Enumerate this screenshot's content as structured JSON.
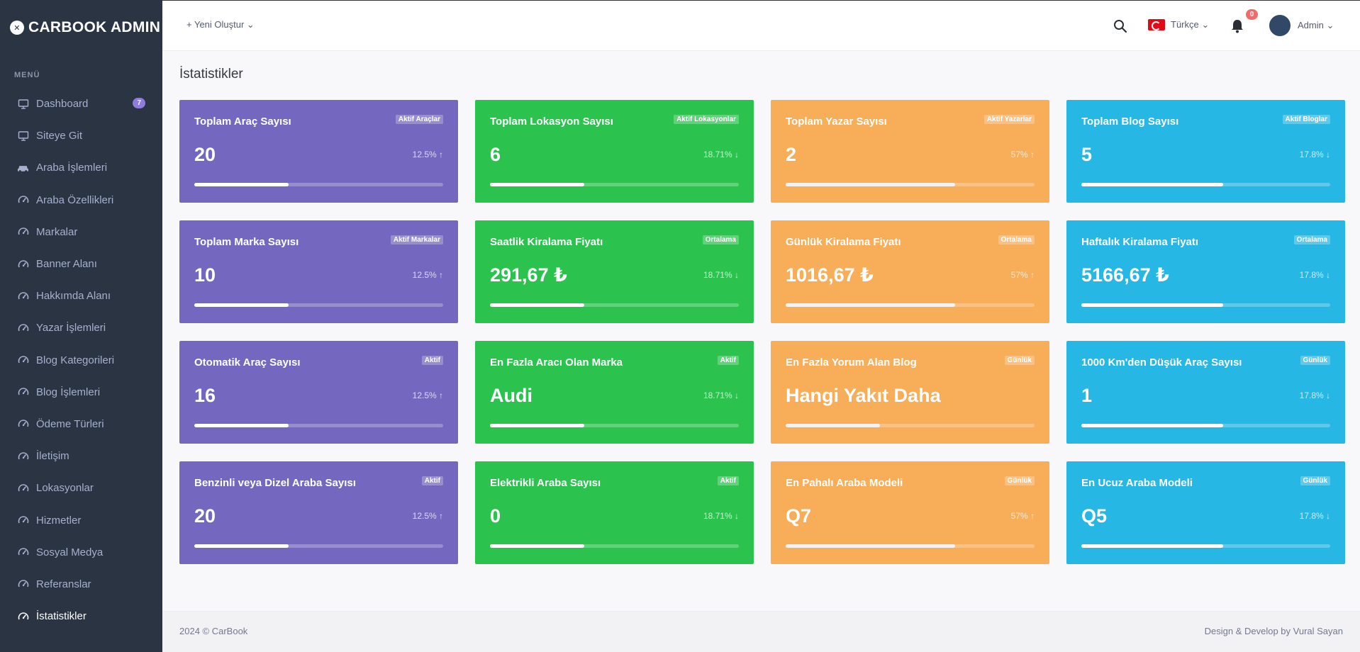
{
  "brand": {
    "name": "CARBOOK ADMIN",
    "icon": "x-logo-icon"
  },
  "sidebar": {
    "menu_title": "MENÜ",
    "items": [
      {
        "label": "Dashboard",
        "icon": "monitor-icon",
        "badge": "7"
      },
      {
        "label": "Siteye Git",
        "icon": "monitor-icon"
      },
      {
        "label": "Araba İşlemleri",
        "icon": "car-icon"
      },
      {
        "label": "Araba Özellikleri",
        "icon": "speedometer-icon"
      },
      {
        "label": "Markalar",
        "icon": "speedometer-icon"
      },
      {
        "label": "Banner Alanı",
        "icon": "speedometer-icon"
      },
      {
        "label": "Hakkımda Alanı",
        "icon": "speedometer-icon"
      },
      {
        "label": "Yazar İşlemleri",
        "icon": "speedometer-icon"
      },
      {
        "label": "Blog Kategorileri",
        "icon": "speedometer-icon"
      },
      {
        "label": "Blog İşlemleri",
        "icon": "speedometer-icon"
      },
      {
        "label": "Ödeme Türleri",
        "icon": "speedometer-icon"
      },
      {
        "label": "İletişim",
        "icon": "speedometer-icon"
      },
      {
        "label": "Lokasyonlar",
        "icon": "speedometer-icon"
      },
      {
        "label": "Hizmetler",
        "icon": "speedometer-icon"
      },
      {
        "label": "Sosyal Medya",
        "icon": "speedometer-icon"
      },
      {
        "label": "Referanslar",
        "icon": "speedometer-icon"
      },
      {
        "label": "İstatistikler",
        "icon": "speedometer-icon",
        "active": true
      }
    ]
  },
  "topbar": {
    "create_new": "+ Yeni Oluştur ⌄",
    "language": "Türkçe ⌄",
    "notification_count": "0",
    "user": "Admin ⌄"
  },
  "page": {
    "title": "İstatistikler"
  },
  "cards": [
    {
      "title": "Toplam Araç Sayısı",
      "badge": "Aktif Araçlar",
      "value": "20",
      "pct": "12.5% ↑",
      "color": "purple",
      "progress": 0.38
    },
    {
      "title": "Toplam Lokasyon Sayısı",
      "badge": "Aktif Lokasyonlar",
      "value": "6",
      "pct": "18.71% ↓",
      "color": "green",
      "progress": 0.38
    },
    {
      "title": "Toplam Yazar Sayısı",
      "badge": "Aktif Yazarlar",
      "value": "2",
      "pct": "57% ↑",
      "color": "orange",
      "progress": 0.68
    },
    {
      "title": "Toplam Blog Sayısı",
      "badge": "Aktif Bloglar",
      "value": "5",
      "pct": "17.8% ↓",
      "color": "blue",
      "progress": 0.57
    },
    {
      "title": "Toplam Marka Sayısı",
      "badge": "Aktif Markalar",
      "value": "10",
      "pct": "12.5% ↑",
      "color": "purple",
      "progress": 0.38
    },
    {
      "title": "Saatlik Kiralama Fiyatı",
      "badge": "Ortalama",
      "value": "291,67 ₺",
      "pct": "18.71% ↓",
      "color": "green",
      "progress": 0.38
    },
    {
      "title": "Günlük Kiralama Fiyatı",
      "badge": "Ortalama",
      "value": "1016,67 ₺",
      "pct": "57% ↑",
      "color": "orange",
      "progress": 0.68
    },
    {
      "title": "Haftalık Kiralama Fiyatı",
      "badge": "Ortalama",
      "value": "5166,67 ₺",
      "pct": "17.8% ↓",
      "color": "blue",
      "progress": 0.57
    },
    {
      "title": "Otomatik Araç Sayısı",
      "badge": "Aktif",
      "value": "16",
      "pct": "12.5% ↑",
      "color": "purple",
      "progress": 0.38
    },
    {
      "title": "En Fazla Aracı Olan Marka",
      "badge": "Aktif",
      "value": "Audi",
      "pct": "18.71% ↓",
      "color": "green",
      "progress": 0.38
    },
    {
      "title": "En Fazla Yorum Alan Blog",
      "badge": "Günlük",
      "value": "Hangi Yakıt Daha Verimli",
      "pct": "",
      "color": "orange",
      "progress": 0.38
    },
    {
      "title": "1000 Km'den Düşük Araç Sayısı",
      "badge": "Günlük",
      "value": "1",
      "pct": "17.8% ↓",
      "color": "blue",
      "progress": 0.57
    },
    {
      "title": "Benzinli veya Dizel Araba Sayısı",
      "badge": "Aktif",
      "value": "20",
      "pct": "12.5% ↑",
      "color": "purple",
      "progress": 0.38
    },
    {
      "title": "Elektrikli Araba Sayısı",
      "badge": "Aktif",
      "value": "0",
      "pct": "18.71% ↓",
      "color": "green",
      "progress": 0.38
    },
    {
      "title": "En Pahalı Araba Modeli",
      "badge": "Günlük",
      "value": "Q7",
      "pct": "57% ↑",
      "color": "orange",
      "progress": 0.68
    },
    {
      "title": "En Ucuz Araba Modeli",
      "badge": "Günlük",
      "value": "Q5",
      "pct": "17.8% ↓",
      "color": "blue",
      "progress": 0.57
    }
  ],
  "footer": {
    "left": "2024 © CarBook",
    "right": "Design & Develop by Vural Sayan"
  }
}
